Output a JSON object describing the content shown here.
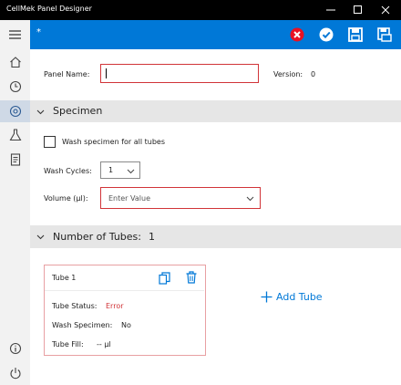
{
  "window": {
    "title": "CellMek Panel Designer",
    "minimize": "─",
    "maximize": "☐",
    "close": "✕"
  },
  "commandbar": {
    "dirty_marker": "*",
    "icons": [
      "discard-icon",
      "validate-icon",
      "save-icon",
      "save-as-icon"
    ],
    "accent": "#0078d7",
    "discard_color": "#e81123"
  },
  "sidebar": {
    "items": [
      "menu-icon",
      "home-icon",
      "history-icon",
      "panels-icon",
      "flask-icon",
      "report-icon"
    ],
    "bottom_items": [
      "info-icon",
      "power-icon"
    ],
    "active_item": "panels-icon"
  },
  "panel": {
    "name_label": "Panel Name:",
    "name_value": "",
    "version_label": "Version:",
    "version_value": "0"
  },
  "specimen": {
    "section_title": "Specimen",
    "wash_all_label": "Wash specimen for all tubes",
    "wash_all_checked": false,
    "wash_cycles_label": "Wash Cycles:",
    "wash_cycles_value": "1",
    "volume_label": "Volume (µl):",
    "volume_placeholder": "Enter Value"
  },
  "tubes": {
    "section_title": "Number of Tubes:",
    "count": "1",
    "add_label": "Add Tube",
    "items": [
      {
        "title": "Tube 1",
        "status_label": "Tube Status:",
        "status_value": "Error",
        "wash_label": "Wash Specimen:",
        "wash_value": "No",
        "fill_label": "Tube Fill:",
        "fill_value": "-- µl"
      }
    ],
    "error_color": "#d13438"
  }
}
